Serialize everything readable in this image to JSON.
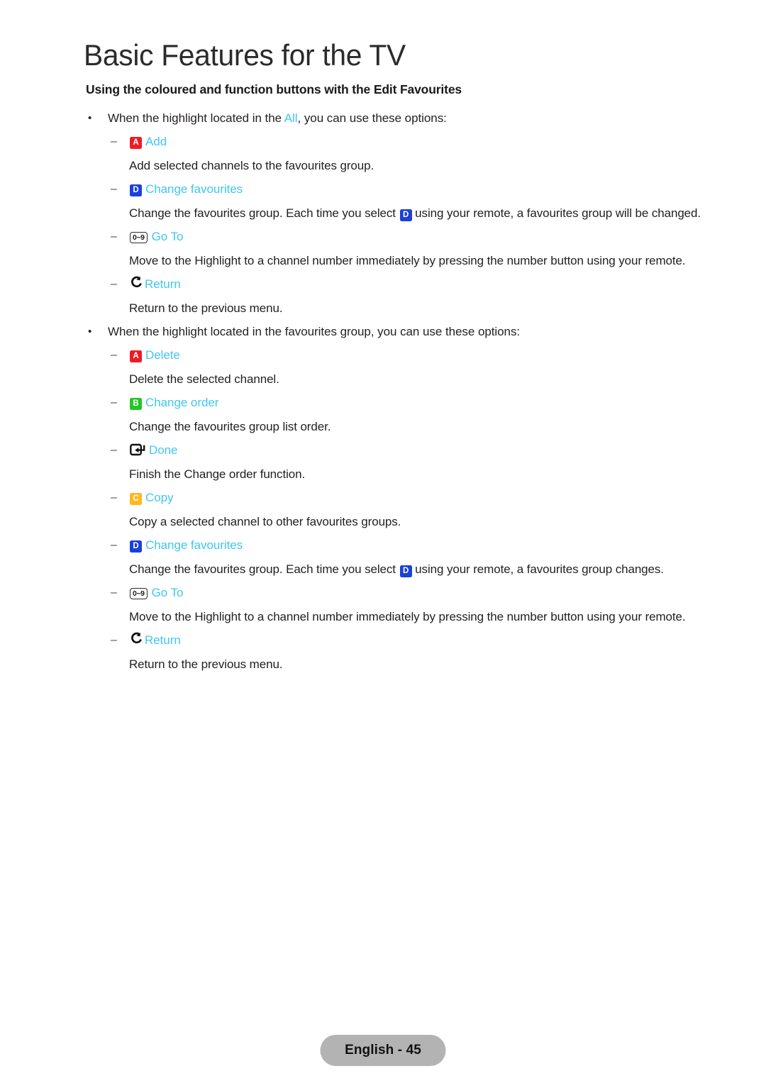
{
  "document": {
    "title": "Basic Features for the TV",
    "section_heading": "Using the coloured and function buttons with the Edit Favourites",
    "footer_label": "English - 45"
  },
  "colors": {
    "button_a": "#ec1c24",
    "button_b": "#22c722",
    "button_c": "#ffb81c",
    "button_d": "#1b41d8",
    "link_cyan": "#3fc6f4",
    "body_text": "#231f20",
    "footer_pill": "#b3b3b3"
  },
  "bullets": {
    "first": {
      "prefix": "When the highlight located in the ",
      "highlight": "All",
      "suffix": ", you can use these options:"
    },
    "second": {
      "text": "When the highlight located in the favourites group, you can use these options:"
    }
  },
  "options": {
    "add": {
      "key": "A",
      "label": "Add",
      "description": "Add selected channels to the favourites group."
    },
    "change_favourites_1": {
      "key": "D",
      "label": "Change favourites",
      "desc_prefix": "Change the favourites group. Each time you select ",
      "desc_inline_key": "D",
      "desc_suffix": " using your remote, a favourites group will be changed."
    },
    "go_to_1": {
      "key": "0~9",
      "label": "Go To",
      "description": "Move to the Highlight to a channel number immediately by pressing the number button using your remote."
    },
    "return_1": {
      "key": "return-arrow",
      "label": "Return",
      "description": "Return to the previous menu."
    },
    "delete": {
      "key": "A",
      "label": "Delete",
      "description": "Delete the selected channel."
    },
    "change_order": {
      "key": "B",
      "label": "Change order",
      "description": "Change the favourites group list order."
    },
    "done": {
      "key": "enter-arrow",
      "label": "Done",
      "description": "Finish the Change order function."
    },
    "copy": {
      "key": "C",
      "label": "Copy",
      "description": "Copy a selected channel to other favourites groups."
    },
    "change_favourites_2": {
      "key": "D",
      "label": "Change favourites",
      "desc_prefix": "Change the favourites group. Each time you select ",
      "desc_inline_key": "D",
      "desc_suffix": " using your remote, a favourites group changes."
    },
    "go_to_2": {
      "key": "0~9",
      "label": "Go To",
      "description": "Move to the Highlight to a channel number immediately by pressing the number button using your remote."
    },
    "return_2": {
      "key": "return-arrow",
      "label": "Return",
      "description": "Return to the previous menu."
    }
  },
  "marks": {
    "bullet": "•",
    "dash": "–"
  }
}
